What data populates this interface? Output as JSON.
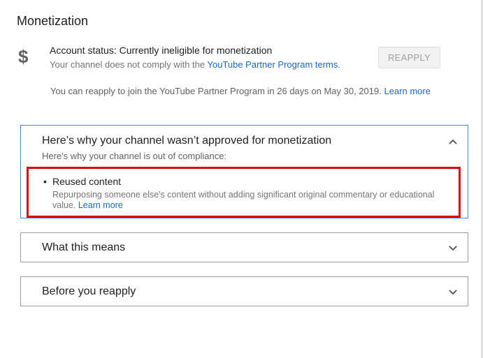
{
  "page_title": "Monetization",
  "status": {
    "icon": "dollar-icon",
    "title": "Account status: Currently ineligible for monetization",
    "desc_prefix": "Your channel does not comply with the ",
    "desc_link": "YouTube Partner Program terms",
    "desc_suffix": ".",
    "reapply_label": "REAPPLY",
    "note_text": "You can reapply to join the YouTube Partner Program in 26 days on May 30, 2019. ",
    "note_link": "Learn more"
  },
  "panels": [
    {
      "heading": "Here’s why your channel wasn’t approved for monetization",
      "subheading": "Here's why your channel is out of compliance:",
      "reasons": [
        {
          "title": "Reused content",
          "description": "Repurposing someone else's content without adding significant original commentary or educational value.",
          "link": "Learn more"
        }
      ],
      "expanded": true
    },
    {
      "heading": "What this means",
      "expanded": false
    },
    {
      "heading": "Before you reapply",
      "expanded": false
    }
  ],
  "colors": {
    "link": "#1a67c9",
    "highlight": "#e00000",
    "active_border": "#4285f4"
  }
}
